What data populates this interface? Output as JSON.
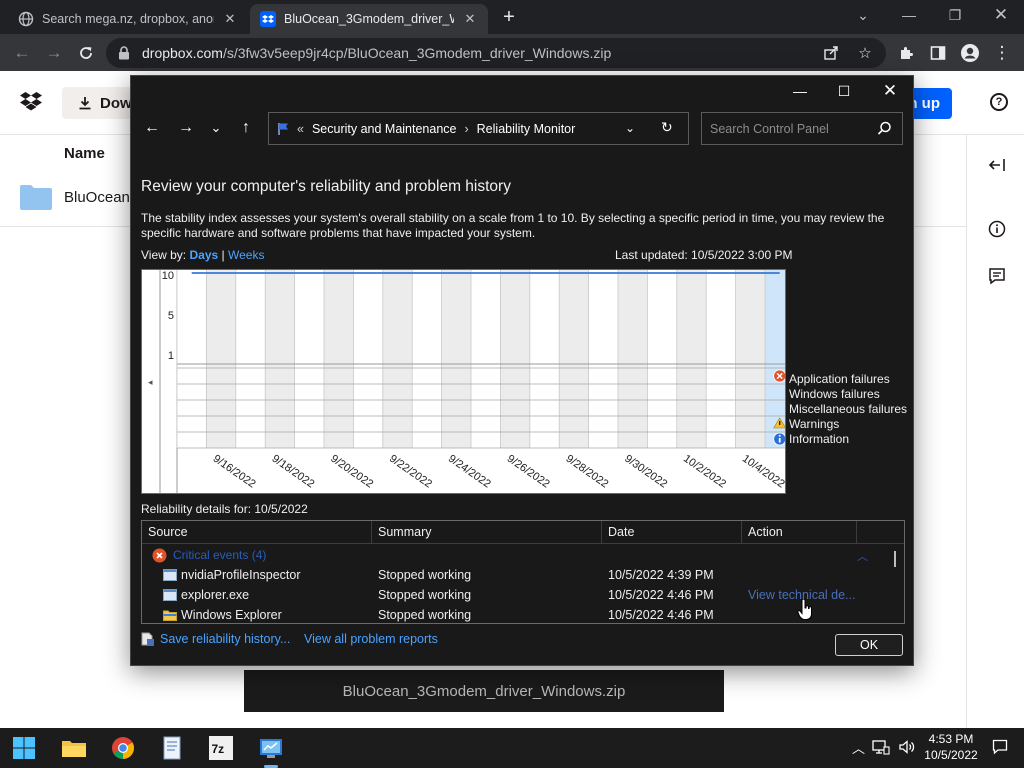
{
  "browser": {
    "tabs": [
      {
        "title": "Search mega.nz, dropbox, anonfiles",
        "active": false
      },
      {
        "title": "BluOcean_3Gmodem_driver_Windows.zip",
        "active": true
      }
    ],
    "url_domain": "dropbox.com",
    "url_path": "/s/3fw3v5eep9jr4cp/BluOcean_3Gmodem_driver_Windows.zip"
  },
  "dropbox": {
    "download_label": "Dow",
    "signup_label": "n up",
    "name_header": "Name",
    "file_name": "BluOcean",
    "footer_filename": "BluOcean_3Gmodem_driver_Windows.zip",
    "colors": {
      "brand": "#0061fe"
    }
  },
  "reliability": {
    "breadcrumb_prefix": "«",
    "breadcrumb": [
      "Security and Maintenance",
      "Reliability Monitor"
    ],
    "search_placeholder": "Search Control Panel",
    "heading": "Review your computer's reliability and problem history",
    "description": "The stability index assesses your system's overall stability on a scale from 1 to 10. By selecting a specific period in time, you may review the specific hardware and software problems that have impacted your system.",
    "view_by_label": "View by:",
    "view_days": "Days",
    "view_sep": "|",
    "view_weeks": "Weeks",
    "last_updated": "Last updated: 10/5/2022 3:00 PM",
    "legend": [
      "Application failures",
      "Windows failures",
      "Miscellaneous failures",
      "Warnings",
      "Information"
    ],
    "details_label": "Reliability details for: 10/5/2022",
    "columns": [
      "Source",
      "Summary",
      "Date",
      "Action"
    ],
    "group_label": "Critical events (4)",
    "rows": [
      {
        "source": "nvidiaProfileInspector",
        "summary": "Stopped working",
        "date": "10/5/2022 4:39 PM",
        "action": "",
        "icon": "app-icon"
      },
      {
        "source": "explorer.exe",
        "summary": "Stopped working",
        "date": "10/5/2022 4:46 PM",
        "action": "View technical de...",
        "icon": "app-icon"
      },
      {
        "source": "Windows Explorer",
        "summary": "Stopped working",
        "date": "10/5/2022 4:46 PM",
        "action": "",
        "icon": "folder-icon"
      }
    ],
    "save_history": "Save reliability history...",
    "view_reports": "View all problem reports",
    "ok_label": "OK"
  },
  "chart_data": {
    "type": "line",
    "title": "",
    "y_ticks": [
      "10",
      "5",
      "1"
    ],
    "ylim": [
      1,
      10
    ],
    "x_labels": [
      "9/16/2022",
      "9/18/2022",
      "9/20/2022",
      "9/22/2022",
      "9/24/2022",
      "9/26/2022",
      "9/28/2022",
      "9/30/2022",
      "10/2/2022",
      "10/4/2022"
    ],
    "x": [
      "9/15/2022",
      "9/16/2022",
      "9/17/2022",
      "9/18/2022",
      "9/19/2022",
      "9/20/2022",
      "9/21/2022",
      "9/22/2022",
      "9/23/2022",
      "9/24/2022",
      "9/25/2022",
      "9/26/2022",
      "9/27/2022",
      "9/28/2022",
      "9/29/2022",
      "9/30/2022",
      "10/1/2022",
      "10/2/2022",
      "10/3/2022",
      "10/4/2022",
      "10/5/2022"
    ],
    "series": [
      {
        "name": "Stability index",
        "values": [
          10,
          10,
          10,
          10,
          10,
          10,
          10,
          10,
          10,
          10,
          10,
          10,
          10,
          10,
          10,
          10,
          10,
          10,
          10,
          10,
          10
        ]
      }
    ],
    "selected_date": "10/5/2022",
    "events": [
      {
        "date": "10/5/2022",
        "category": "Application failures",
        "icon": "error-icon"
      },
      {
        "date": "10/5/2022",
        "category": "Warnings",
        "icon": "warning-icon"
      },
      {
        "date": "10/5/2022",
        "category": "Information",
        "icon": "info-icon"
      }
    ],
    "grid": true
  },
  "taskbar": {
    "clock_time": "4:53 PM",
    "clock_date": "10/5/2022"
  }
}
